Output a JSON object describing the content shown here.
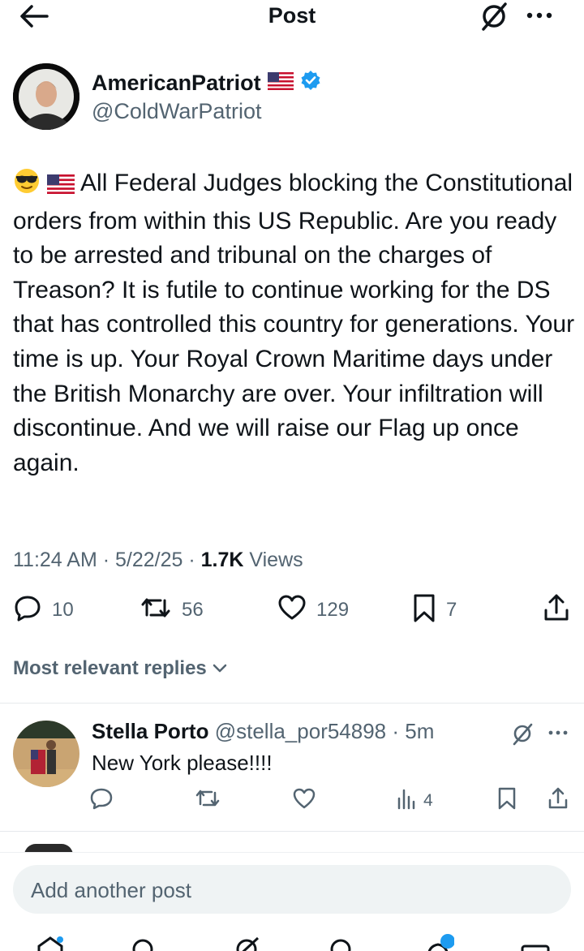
{
  "header": {
    "title": "Post"
  },
  "author": {
    "display_name": "AmericanPatriot",
    "handle": "@ColdWarPatriot",
    "verified": true
  },
  "tweet": {
    "text": "All Federal Judges blocking the Constitutional orders from within this US Republic. Are you ready to be arrested and tribunal on the charges of Treason? It is futile to continue working for the DS that has controlled this country for generations. Your time is up. Your Royal Crown Maritime days under the British Monarchy are over. Your infiltration will discontinue. And we will raise our Flag up once again.",
    "time": "11:24 AM",
    "date": "5/22/25",
    "views_count": "1.7K",
    "views_label": "Views"
  },
  "actions": {
    "replies": "10",
    "reposts": "56",
    "likes": "129",
    "bookmarks": "7"
  },
  "replies_section": {
    "header": "Most relevant replies"
  },
  "replies": [
    {
      "name": "Stella Porto",
      "handle": "@stella_por54898",
      "time": "5m",
      "text": "New York please!!!!",
      "views": "4"
    }
  ],
  "composer": {
    "placeholder": "Add another post"
  },
  "colors": {
    "text": "#0f1419",
    "muted": "#536471",
    "verified": "#1d9bf0",
    "composer_bg": "#eff3f4"
  }
}
